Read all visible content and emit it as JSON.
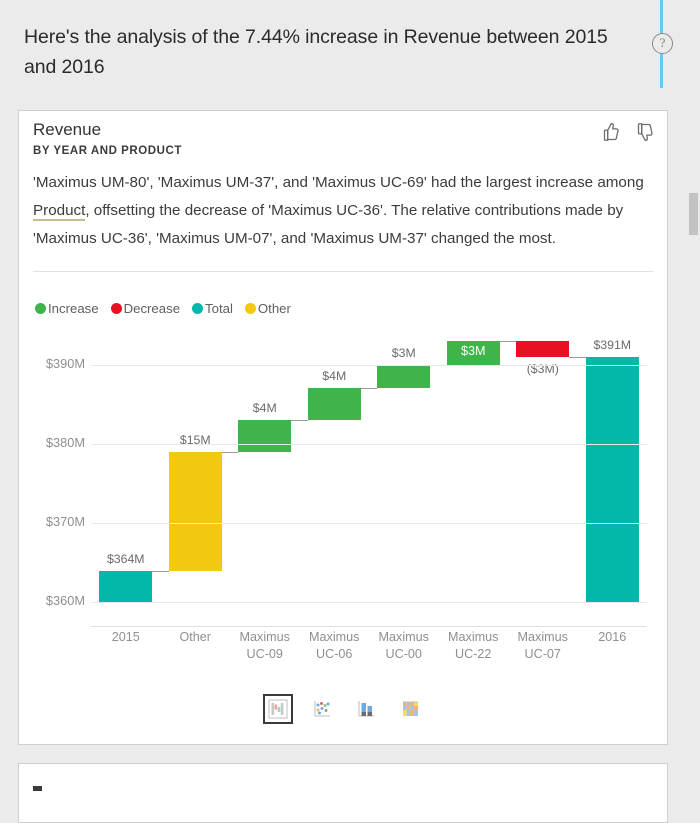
{
  "header": {
    "headline": "Here's the analysis of the 7.44% increase in Revenue between 2015 and 2016",
    "help_icon": "help-circle-icon"
  },
  "scrollbar": {
    "orientation": "vertical"
  },
  "card": {
    "title": "Revenue",
    "subtitle": "BY YEAR AND PRODUCT",
    "feedback": {
      "thumbs_up": "thumbs-up-icon",
      "thumbs_down": "thumbs-down-icon"
    },
    "narrative": {
      "part1": "'Maximus UM-80', 'Maximus UM-37', and 'Maximus UC-69' had the largest increase among ",
      "highlight": "Product",
      "part2": ", offsetting the decrease of 'Maximus UC-36'. The relative contributions made by 'Maximus UC-36', 'Maximus UM-07', and 'Maximus UM-37' changed the most."
    }
  },
  "legend": [
    {
      "label": "Increase",
      "color": "#3eb44a"
    },
    {
      "label": "Decrease",
      "color": "#e81123"
    },
    {
      "label": "Total",
      "color": "#01b8aa"
    },
    {
      "label": "Other",
      "color": "#f2c811"
    }
  ],
  "chart_type_selector": {
    "options": [
      {
        "name": "waterfall-chart-icon",
        "selected": true
      },
      {
        "name": "scatter-chart-icon",
        "selected": false
      },
      {
        "name": "column-chart-icon",
        "selected": false
      },
      {
        "name": "stacked-area-chart-icon",
        "selected": false
      }
    ]
  },
  "next_card": {
    "placeholder": ""
  },
  "chart_data": {
    "type": "bar",
    "subtype": "waterfall",
    "title": "Revenue",
    "subtitle": "BY YEAR AND PRODUCT",
    "xlabel": "",
    "ylabel": "",
    "ylim": [
      357,
      393
    ],
    "yticks": [
      360,
      370,
      380,
      390
    ],
    "ytick_labels": [
      "$360M",
      "$370M",
      "$380M",
      "$390M"
    ],
    "grid": true,
    "legend_position": "top-left",
    "categories": [
      "2015",
      "Other",
      "Maximus UC-09",
      "Maximus UC-06",
      "Maximus UC-00",
      "Maximus UC-22",
      "Maximus UC-07",
      "2016"
    ],
    "category_lines": [
      [
        "2015",
        ""
      ],
      [
        "Other",
        ""
      ],
      [
        "Maximus",
        "UC-09"
      ],
      [
        "Maximus",
        "UC-06"
      ],
      [
        "Maximus",
        "UC-00"
      ],
      [
        "Maximus",
        "UC-22"
      ],
      [
        "Maximus",
        "UC-07"
      ],
      [
        "2016",
        ""
      ]
    ],
    "bars": [
      {
        "category": "2015",
        "kind": "total",
        "value": 364,
        "start": 360,
        "end": 364,
        "label": "$364M",
        "label_pos": "above",
        "color": "#01b8aa"
      },
      {
        "category": "Other",
        "kind": "other",
        "value": 15,
        "start": 364,
        "end": 379,
        "label": "$15M",
        "label_pos": "above",
        "color": "#f2c811"
      },
      {
        "category": "Maximus UC-09",
        "kind": "increase",
        "value": 4,
        "start": 379,
        "end": 383,
        "label": "$4M",
        "label_pos": "above",
        "color": "#3eb44a"
      },
      {
        "category": "Maximus UC-06",
        "kind": "increase",
        "value": 4,
        "start": 383,
        "end": 387,
        "label": "$4M",
        "label_pos": "above",
        "color": "#3eb44a"
      },
      {
        "category": "Maximus UC-00",
        "kind": "increase",
        "value": 3,
        "start": 387,
        "end": 390,
        "label": "$3M",
        "label_pos": "above",
        "color": "#3eb44a"
      },
      {
        "category": "Maximus UC-22",
        "kind": "increase",
        "value": 3,
        "start": 390,
        "end": 393,
        "label": "$3M",
        "label_pos": "inside",
        "color": "#3eb44a"
      },
      {
        "category": "Maximus UC-07",
        "kind": "decrease",
        "value": -3,
        "start": 393,
        "end": 391,
        "label": "($3M)",
        "label_pos": "below",
        "color": "#e81123"
      },
      {
        "category": "2016",
        "kind": "total",
        "value": 391,
        "start": 360,
        "end": 391,
        "label": "$391M",
        "label_pos": "above",
        "color": "#01b8aa"
      }
    ]
  }
}
